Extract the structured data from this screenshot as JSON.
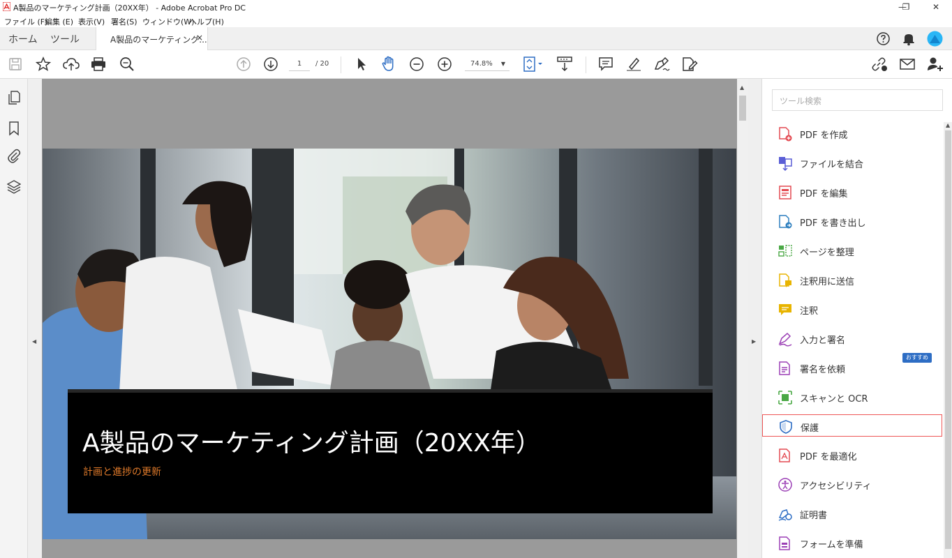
{
  "window": {
    "title": "A製品のマーケティング計画（20XX年） - Adobe Acrobat Pro DC",
    "minimize": "—",
    "restore": "❐",
    "close": "✕"
  },
  "menubar": [
    "ファイル (F)",
    "編集 (E)",
    "表示(V)",
    "署名(S)",
    "ウィンドウ(W)",
    "ヘルプ(H)"
  ],
  "tabs": {
    "home": "ホーム",
    "tools": "ツール",
    "document": "A製品のマーケティング...",
    "close": "×"
  },
  "toolbar": {
    "page_current": "1",
    "page_total": "/ 20",
    "zoom": "74.8%",
    "zoom_caret": "▼"
  },
  "document": {
    "cover_title": "A製品のマーケティング計画（20XX年）",
    "cover_subtitle": "計画と進捗の更新"
  },
  "rightpane": {
    "search_placeholder": "ツール検索",
    "badge": "おすすめ",
    "tools": [
      {
        "label": "PDF を作成",
        "icon": "create-pdf-icon",
        "color": "#e34850"
      },
      {
        "label": "ファイルを結合",
        "icon": "combine-files-icon",
        "color": "#5b5fd6"
      },
      {
        "label": "PDF を編集",
        "icon": "edit-pdf-icon",
        "color": "#e34850"
      },
      {
        "label": "PDF を書き出し",
        "icon": "export-pdf-icon",
        "color": "#2d7fbf"
      },
      {
        "label": "ページを整理",
        "icon": "organize-pages-icon",
        "color": "#4aa845"
      },
      {
        "label": "注釈用に送信",
        "icon": "send-for-comments-icon",
        "color": "#e8b400"
      },
      {
        "label": "注釈",
        "icon": "comment-icon",
        "color": "#e8b400"
      },
      {
        "label": "入力と署名",
        "icon": "fill-sign-icon",
        "color": "#9b3fb5"
      },
      {
        "label": "署名を依頼",
        "icon": "request-signature-icon",
        "color": "#9b3fb5"
      },
      {
        "label": "スキャンと OCR",
        "icon": "scan-ocr-icon",
        "color": "#4aa845"
      },
      {
        "label": "保護",
        "icon": "protect-icon",
        "color": "#2d6dc4"
      },
      {
        "label": "PDF を最適化",
        "icon": "optimize-pdf-icon",
        "color": "#e34850"
      },
      {
        "label": "アクセシビリティ",
        "icon": "accessibility-icon",
        "color": "#9b3fb5"
      },
      {
        "label": "証明書",
        "icon": "certificates-icon",
        "color": "#2d6dc4"
      },
      {
        "label": "フォームを準備",
        "icon": "prepare-form-icon",
        "color": "#9b3fb5"
      }
    ]
  }
}
